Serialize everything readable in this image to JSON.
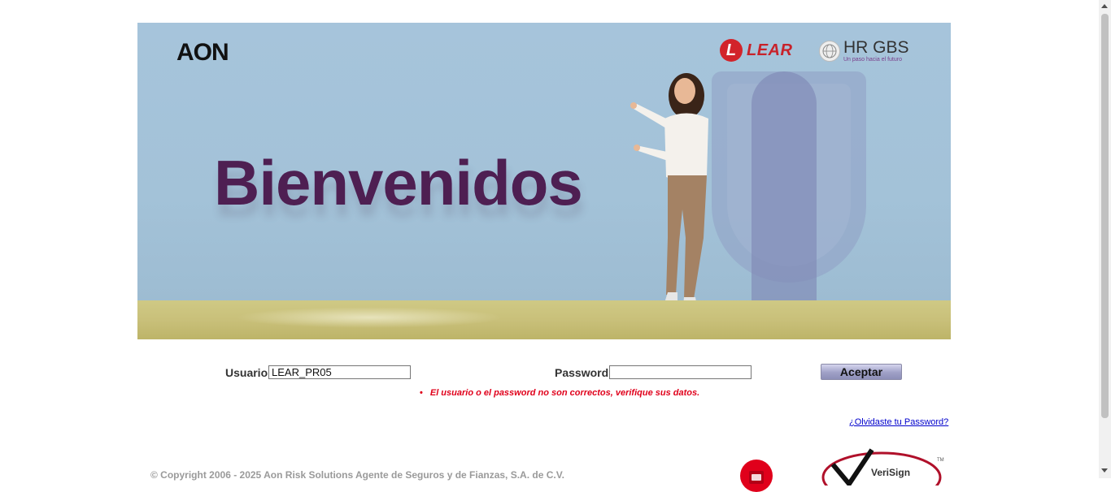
{
  "banner": {
    "aon_logo": "AON",
    "lear_logo": "LEAR",
    "lear_badge": "L",
    "hrgbs_title": "HR GBS",
    "hrgbs_tagline": "Un paso hacia el futuro",
    "welcome": "Bienvenidos"
  },
  "login": {
    "user_label": "Usuario",
    "user_value": "LEAR_PR05",
    "password_label": "Password",
    "password_value": "",
    "submit_label": "Aceptar",
    "error_bullet": "•",
    "error": "El usuario o el password no son correctos, verifique sus datos.",
    "forgot_link": "¿Olvidaste tu Password?"
  },
  "footer": {
    "copyright": "© Copyright 2006 - 2025 Aon Risk Solutions Agente de Seguros y de Fianzas, S.A. de C.V.",
    "verisign": "VeriSign"
  },
  "colors": {
    "banner_bg": "#a6c4db",
    "welcome": "#4e1f52",
    "error": "#e0001b",
    "link": "#0000cc",
    "lear_red": "#c8222a"
  },
  "icons": [
    "lear-logo-icon",
    "hr-gbs-globe-icon",
    "security-seal-icon",
    "verisign-seal-icon"
  ]
}
